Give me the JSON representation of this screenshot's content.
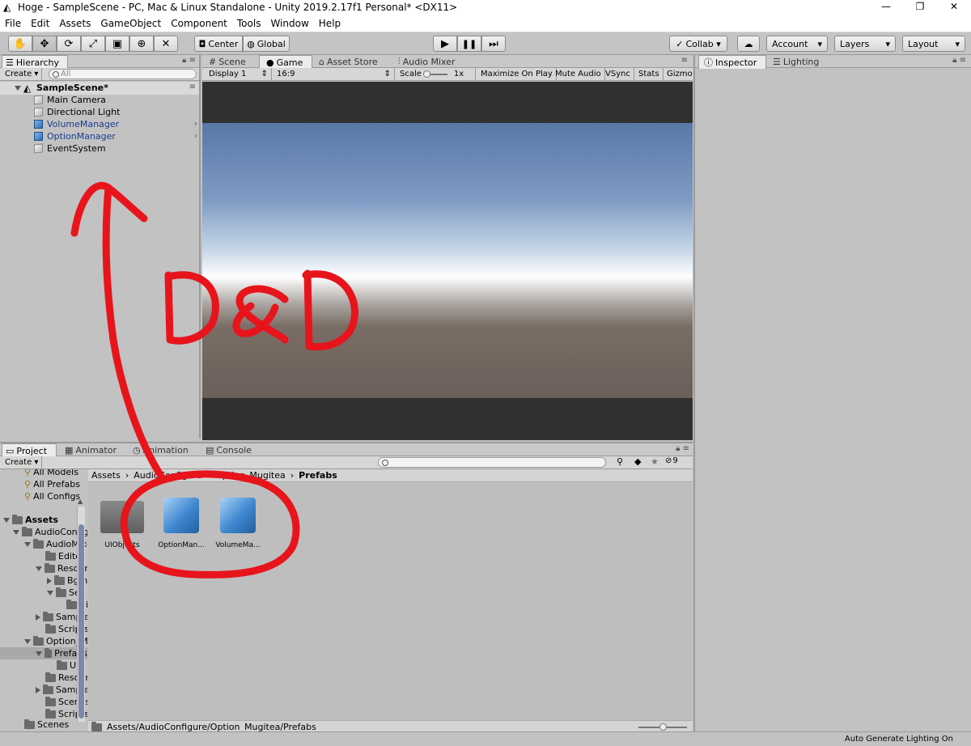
{
  "window": {
    "title": "Hoge - SampleScene - PC, Mac & Linux Standalone - Unity 2019.2.17f1 Personal* <DX11>",
    "controls": [
      "—",
      "❐",
      "✕"
    ]
  },
  "menu": [
    "File",
    "Edit",
    "Assets",
    "GameObject",
    "Component",
    "Tools",
    "Window",
    "Help"
  ],
  "toolbar": {
    "tools": [
      "hand-tool-icon",
      "move-tool-icon",
      "rotate-tool-icon",
      "scale-tool-icon",
      "rect-tool-icon",
      "transform-tool-icon",
      "custom-tool-icon"
    ],
    "pivot": "Center",
    "space": "Global",
    "collab": "Collab ▾",
    "account": "Account",
    "layers": "Layers",
    "layout": "Layout"
  },
  "hierarchy": {
    "tab": "Hierarchy",
    "create": "Create ▾",
    "search_placeholder": "All",
    "scene": "SampleScene*",
    "items": [
      "Main Camera",
      "Directional Light",
      "VolumeManager",
      "OptionManager",
      "EventSystem"
    ]
  },
  "center_tabs": [
    "Scene",
    "Game",
    "Asset Store",
    "Audio Mixer"
  ],
  "game_bar": {
    "display": "Display 1",
    "aspect": "16:9",
    "scale_label": "Scale",
    "scale_value": "1x",
    "maximize": "Maximize On Play",
    "mute": "Mute Audio",
    "vsync": "VSync",
    "stats": "Stats",
    "gizmos": "Gizmo"
  },
  "inspector_tabs": [
    "Inspector",
    "Lighting"
  ],
  "bottom_tabs": [
    "Project",
    "Animator",
    "Animation",
    "Console"
  ],
  "project": {
    "create": "Create ▾",
    "hidden_count": "9",
    "favorites": [
      "All Models",
      "All Prefabs",
      "All Configs"
    ],
    "tree": [
      "Assets",
      "AudioConfigure",
      "AudioMixer",
      "Editor",
      "Resources",
      "Bgm",
      "Se",
      "Ui",
      "Samples",
      "Scripts",
      "Option_Mugitea",
      "Prefabs",
      "UI",
      "Resources",
      "Samples",
      "Scenes",
      "Scripts",
      "Scenes"
    ],
    "breadcrumb": [
      "Assets",
      "AudioConfigure",
      "Option_Mugitea",
      "Prefabs"
    ],
    "assets": [
      "UIObjects",
      "OptionMan...",
      "VolumeMa..."
    ],
    "path": "Assets/AudioConfigure/Option_Mugitea/Prefabs"
  },
  "status": "Auto Generate Lighting On",
  "annotation": {
    "text": "D&D",
    "color": "#e8141c"
  }
}
